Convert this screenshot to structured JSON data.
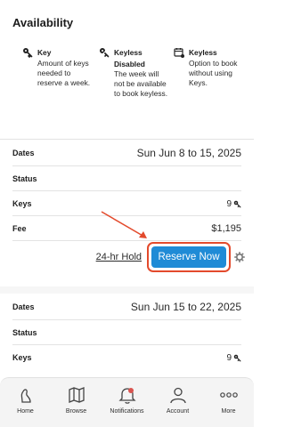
{
  "section_title": "Availability",
  "legend": [
    {
      "icon": "key-icon",
      "title": "Key",
      "subtitle": "",
      "description": "Amount of keys needed to reserve a week."
    },
    {
      "icon": "keyless-icon",
      "title": "Keyless",
      "subtitle": "Disabled",
      "description": "The week will not be available to book keyless."
    },
    {
      "icon": "calendar-key-icon",
      "title": "Keyless",
      "subtitle": "",
      "description": "Option to book without using Keys."
    }
  ],
  "week1": {
    "dates_label": "Dates",
    "dates_value": "Sun Jun 8 to 15, 2025",
    "status_label": "Status",
    "status_value": "",
    "keys_label": "Keys",
    "keys_value": "9",
    "fee_label": "Fee",
    "fee_value": "$1,195"
  },
  "actions": {
    "hold_label": "24-hr Hold",
    "reserve_label": "Reserve Now"
  },
  "week2": {
    "dates_label": "Dates",
    "dates_value": "Sun Jun 15 to 22, 2025",
    "status_label": "Status",
    "status_value": "",
    "keys_label": "Keys",
    "keys_value": "9"
  },
  "nav": [
    {
      "label": "Home",
      "icon": "home-icon"
    },
    {
      "label": "Browse",
      "icon": "map-icon"
    },
    {
      "label": "Notifications",
      "icon": "bell-icon"
    },
    {
      "label": "Account",
      "icon": "user-icon"
    },
    {
      "label": "More",
      "icon": "more-icon"
    }
  ],
  "colors": {
    "accent": "#1f8bd6",
    "highlight": "#e34a2c"
  }
}
